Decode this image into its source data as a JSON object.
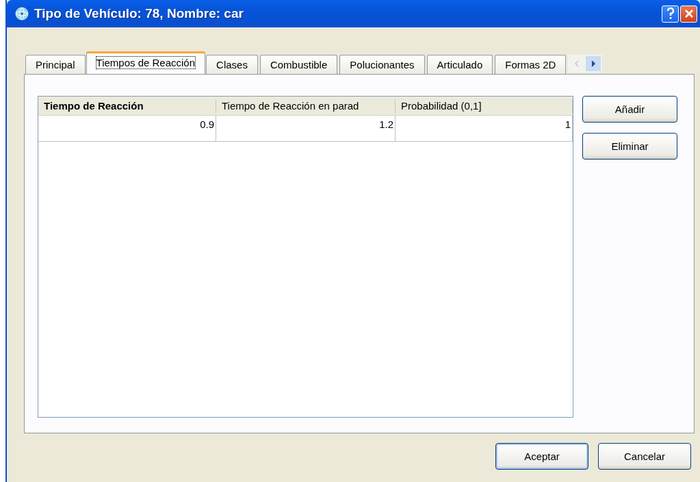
{
  "window": {
    "title": "Tipo de Vehículo: 78, Nombre: car"
  },
  "tabs": [
    {
      "label": "Principal",
      "selected": false
    },
    {
      "label": "Tiempos de Reacción",
      "selected": true
    },
    {
      "label": "Clases",
      "selected": false
    },
    {
      "label": "Combustible",
      "selected": false
    },
    {
      "label": "Polucionantes",
      "selected": false
    },
    {
      "label": "Articulado",
      "selected": false
    },
    {
      "label": "Formas 2D",
      "selected": false
    }
  ],
  "table": {
    "columns": [
      {
        "label": "Tiempo de Reacción",
        "emphasized": true
      },
      {
        "label": "Tiempo de Reacción en parad",
        "emphasized": false
      },
      {
        "label": "Probabilidad (0,1]",
        "emphasized": false
      }
    ],
    "rows": [
      [
        "0.9",
        "1.2",
        "1"
      ]
    ]
  },
  "side_buttons": [
    "Añadir",
    "Eliminar"
  ],
  "buttons": [
    {
      "label": "Aceptar",
      "default": true
    },
    {
      "label": "Cancelar",
      "default": false
    }
  ]
}
